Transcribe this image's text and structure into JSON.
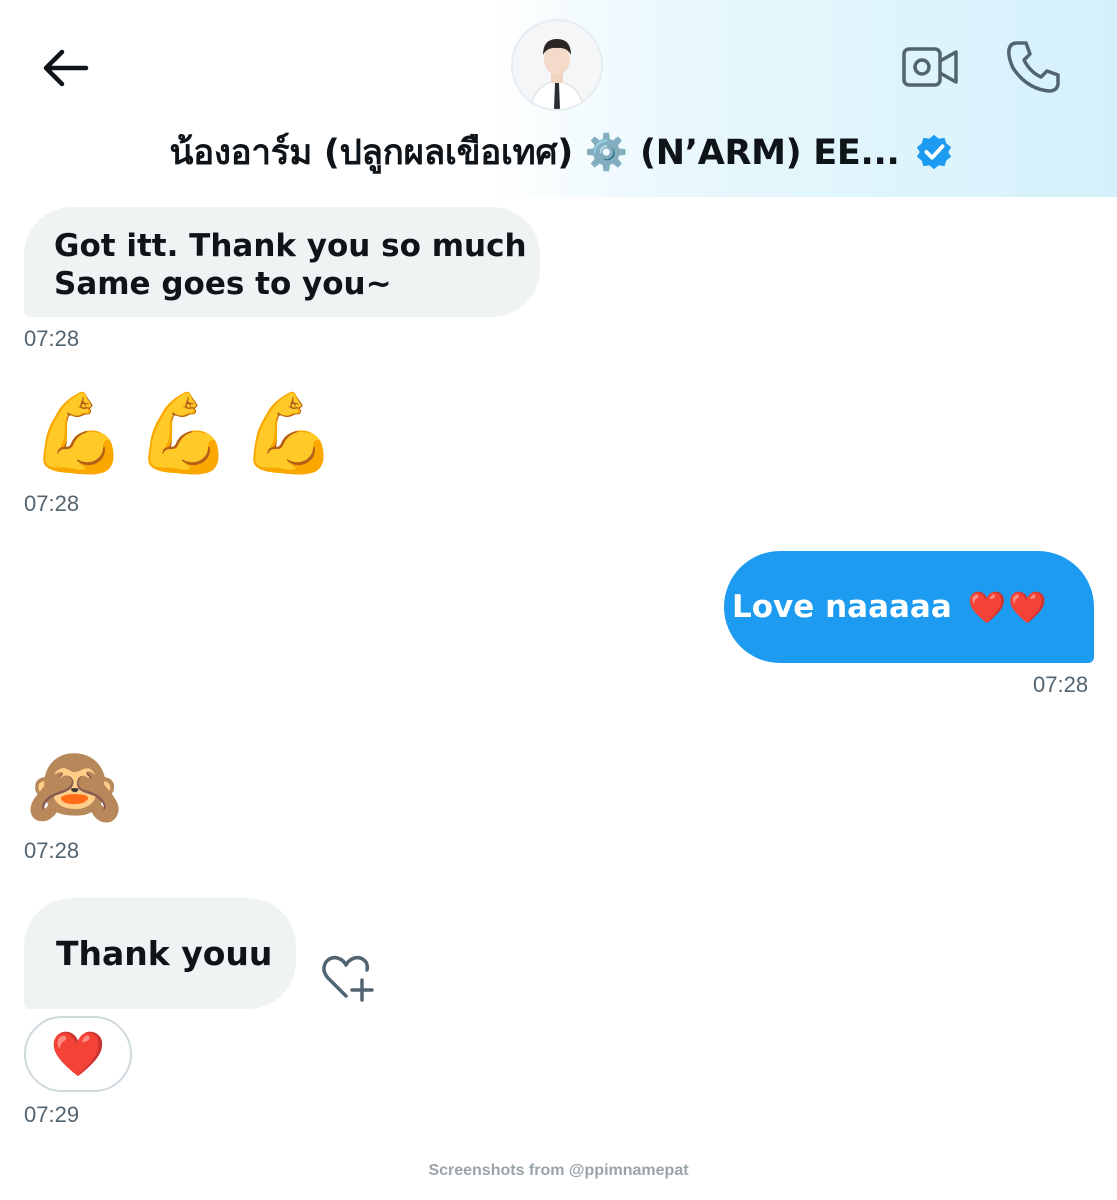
{
  "header": {
    "back_icon": "arrow-left-icon",
    "avatar_icon": "profile-photo",
    "title": "น้องอาร์ม (ปลูกผลเขือเทศ) ⚙️ (N’ARM) EE...",
    "verified_icon": "verified-badge-icon",
    "video_icon": "video-camera-icon",
    "call_icon": "phone-icon"
  },
  "messages": [
    {
      "direction": "incoming",
      "lines": [
        "Got itt. Thank you so much",
        "Same goes to you~"
      ],
      "time": "07:28"
    },
    {
      "direction": "incoming",
      "emoji": [
        "💪",
        "💪",
        "💪"
      ],
      "time": "07:28"
    },
    {
      "direction": "outgoing",
      "text": "Love naaaaa",
      "emoji": "❤️❤️",
      "time": "07:28"
    },
    {
      "direction": "incoming",
      "emoji": [
        "🙈"
      ],
      "time": "07:28"
    },
    {
      "direction": "incoming",
      "text": "Thank youu",
      "reaction": "❤️",
      "add_reaction_icon": "heart-plus-icon",
      "time": "07:29"
    }
  ],
  "credit": "Screenshots from @ppimnamepat",
  "colors": {
    "accent": "#1d9bf0",
    "incoming_bubble": "#eff3f4",
    "timestamp": "#536471",
    "icon_gray": "#536471"
  }
}
